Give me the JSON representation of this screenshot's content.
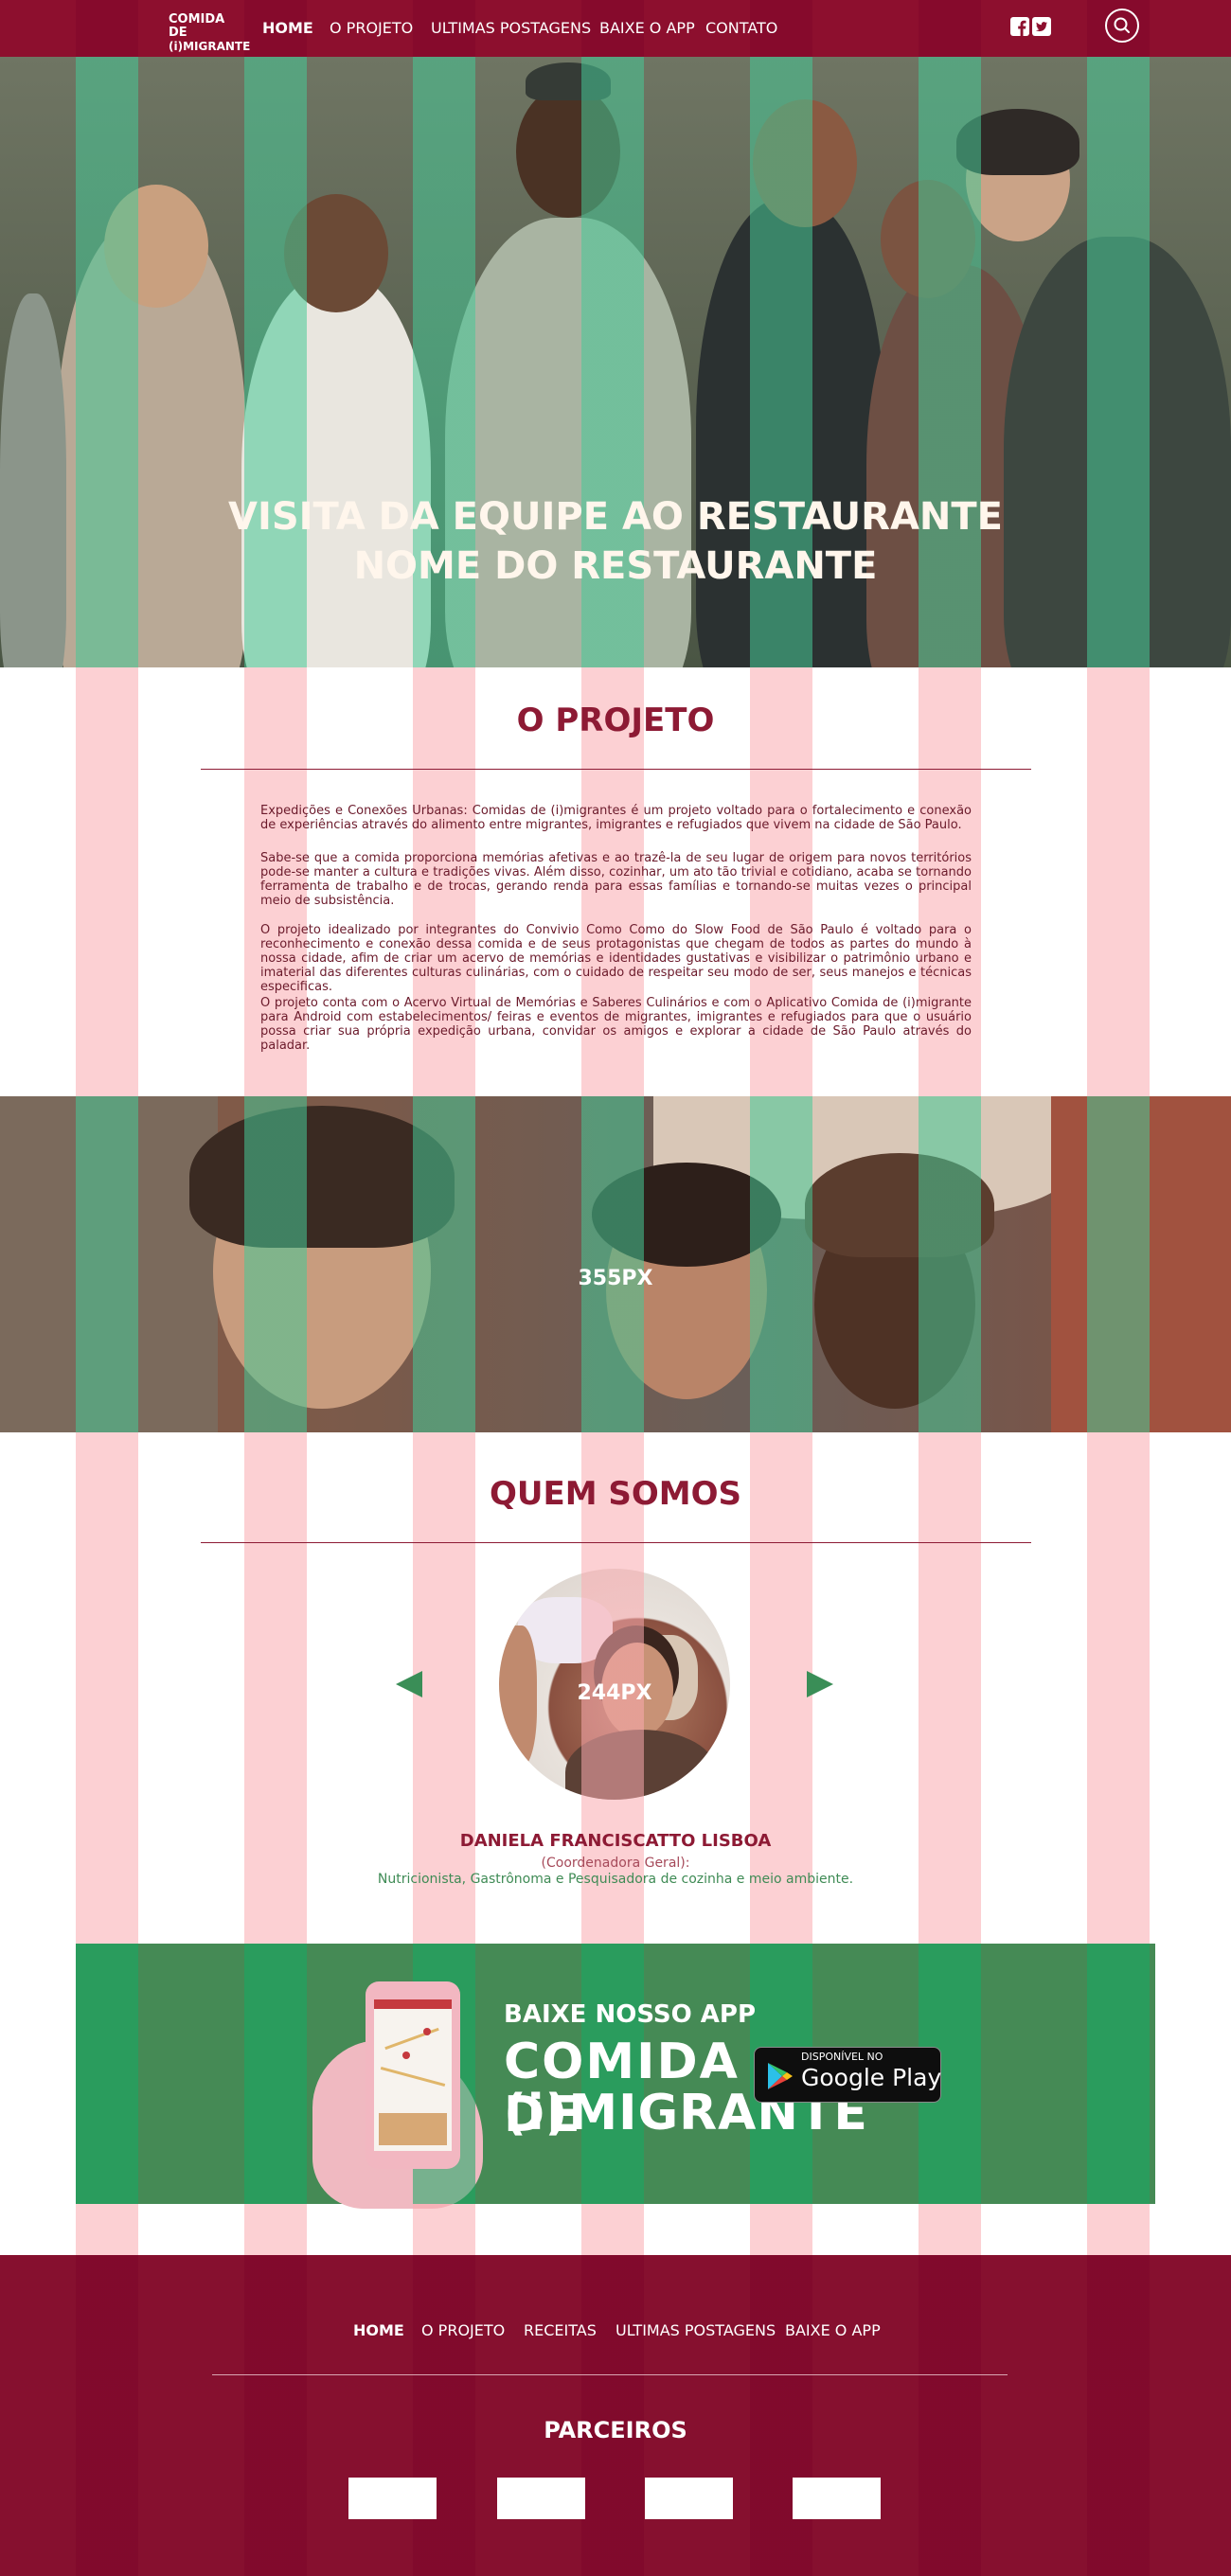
{
  "colors": {
    "brand": "#8d0f2e",
    "title": "#8d1a34",
    "accent_green": "#458a55",
    "overlay_pink": "#faaaaf",
    "overlay_green": "#2fb87a"
  },
  "nav": {
    "logo_line1": "COMIDA DE",
    "logo_line2": "(i)MIGRANTE",
    "links": [
      "HOME",
      "O PROJETO",
      "ULTIMAS POSTAGENS",
      "BAIXE O APP",
      "CONTATO"
    ],
    "social_icons": [
      "facebook-icon",
      "twitter-icon"
    ],
    "search_icon": "search-icon"
  },
  "hero": {
    "title_line1": "VISITA DA EQUIPE AO RESTAURANTE",
    "title_line2": "NOME DO RESTAURANTE"
  },
  "project": {
    "title": "O PROJETO",
    "paragraphs": [
      "Expedições e Conexões Urbanas: Comidas de (i)migrantes é um projeto voltado para o fortalecimento e conexão de experiências através do alimento entre migrantes, imigrantes e refugiados que vivem na cidade de São Paulo.",
      "Sabe-se que a comida proporciona memórias afetivas e ao trazê-la de seu lugar de origem para novos territórios pode-se manter a cultura e tradições vivas. Além disso, cozinhar, um ato tão trivial e cotidiano, acaba se tornando ferramenta de trabalho e de trocas, gerando renda para essas famílias e tornando-se muitas vezes o principal meio de subsistência.",
      "O projeto idealizado por integrantes do Convivio Como Como do Slow Food de São Paulo é voltado para o reconhecimento e conexão dessa comida e de seus protagonistas que chegam de todos as partes do mundo à nossa cidade, afim de criar um acervo de memórias e identidades gustativas e visibilizar o patrimônio urbano e imaterial das diferentes culturas culinárias, com o cuidado de respeitar seu modo de ser, seus manejos e técnicas especificas.",
      "O projeto conta com o Acervo Virtual de Memórias e Saberes Culinários e com o Aplicativo Comida de (i)migrante para Android com estabelecimentos/ feiras e eventos de migrantes, imigrantes e refugiados para que o usuário possa criar sua própria expedição urbana, convidar os amigos e explorar a cidade de São Paulo através do paladar."
    ]
  },
  "band": {
    "label": "355PX"
  },
  "team": {
    "title": "QUEM SOMOS",
    "avatar_label": "244PX",
    "name": "DANIELA FRANCISCATTO LISBOA",
    "role": "(Coordenadora Geral):",
    "description": "Nutricionista, Gastrônoma e Pesquisadora de cozinha e meio ambiente.",
    "prev_icon": "arrow-left-icon",
    "next_icon": "arrow-right-icon"
  },
  "app": {
    "title": "BAIXE NOSSO APP",
    "logo_line1": "COMIDA DE",
    "logo_line2": "(i)MIGRANTE",
    "store_small": "DISPONÍVEL NO",
    "store_big": "Google Play"
  },
  "footer": {
    "links": [
      "HOME",
      "O PROJETO",
      "RECEITAS",
      "ULTIMAS POSTAGENS",
      "BAIXE O APP"
    ],
    "partners_title": "PARCEIROS",
    "partners_count": 4
  }
}
